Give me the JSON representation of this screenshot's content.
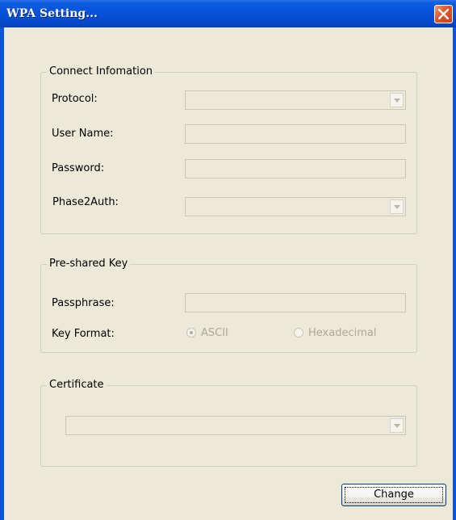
{
  "window": {
    "title": "WPA Setting...",
    "colors": {
      "titlebar": "#0855dd",
      "close": "#e2542c",
      "client": "#ece9d8",
      "disabled_text": "#aca899"
    }
  },
  "connect_info": {
    "legend": "Connect Infomation",
    "protocol_label": "Protocol:",
    "protocol_value": "",
    "username_label": "User Name:",
    "username_value": "",
    "password_label": "Password:",
    "password_value": "",
    "phase2auth_label": "Phase2Auth:",
    "phase2auth_value": ""
  },
  "preshared_key": {
    "legend": "Pre-shared Key",
    "passphrase_label": "Passphrase:",
    "passphrase_value": "",
    "key_format_label": "Key Format:",
    "options": [
      {
        "label": "ASCII",
        "selected": true
      },
      {
        "label": "Hexadecimal",
        "selected": false
      }
    ]
  },
  "certificate": {
    "legend": "Certificate",
    "value": ""
  },
  "actions": {
    "change_label": "Change"
  },
  "icons": {
    "close": "close-icon",
    "dropdown": "chevron-down-icon"
  }
}
